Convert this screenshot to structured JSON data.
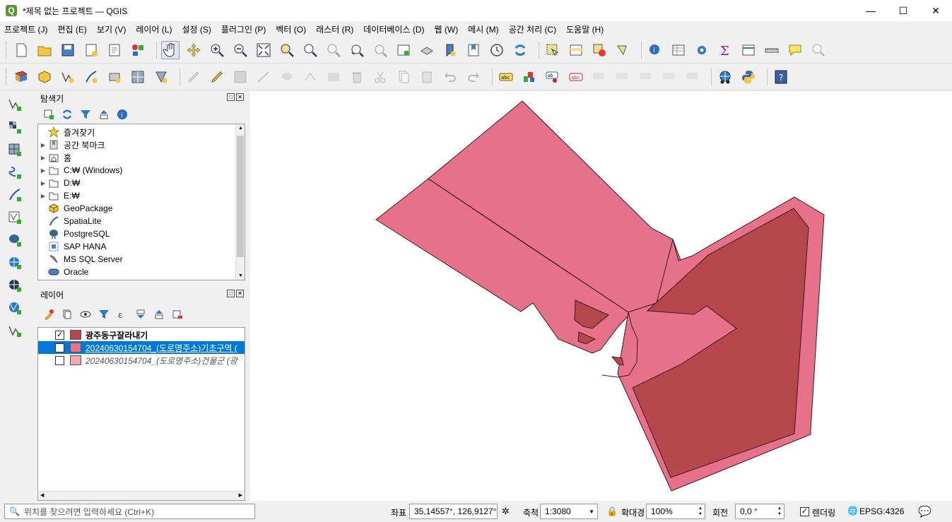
{
  "window": {
    "title": "*제목 없는 프로젝트 — QGIS",
    "app_letter": "Q"
  },
  "menu": [
    "프로젝트 (J)",
    "편집 (E)",
    "보기 (V)",
    "레이어 (L)",
    "설정 (S)",
    "플러그인 (P)",
    "벡터 (O)",
    "래스터 (R)",
    "데이터베이스 (D)",
    "웹 (W)",
    "메시 (M)",
    "공간 처리 (C)",
    "도움말 (H)"
  ],
  "browser": {
    "title": "탐색기",
    "items": [
      {
        "label": "즐겨찾기",
        "icon": "star-icon",
        "expandable": false
      },
      {
        "label": "공간 북마크",
        "icon": "bookmark-icon",
        "expandable": true
      },
      {
        "label": "홈",
        "icon": "home-folder-icon",
        "expandable": true
      },
      {
        "label": "C:₩ (Windows)",
        "icon": "folder-icon",
        "expandable": true
      },
      {
        "label": "D:₩",
        "icon": "folder-icon",
        "expandable": true
      },
      {
        "label": "E:₩",
        "icon": "folder-icon",
        "expandable": true
      },
      {
        "label": "GeoPackage",
        "icon": "geopackage-icon",
        "expandable": false
      },
      {
        "label": "SpatiaLite",
        "icon": "spatialite-icon",
        "expandable": false
      },
      {
        "label": "PostgreSQL",
        "icon": "postgresql-icon",
        "expandable": false
      },
      {
        "label": "SAP HANA",
        "icon": "sap-hana-icon",
        "expandable": false
      },
      {
        "label": "MS SQL Server",
        "icon": "mssql-icon",
        "expandable": false
      },
      {
        "label": "Oracle",
        "icon": "oracle-icon",
        "expandable": false
      }
    ]
  },
  "layers": {
    "title": "레이어",
    "items": [
      {
        "label": "광주동구잘라내기",
        "checked": true,
        "color": "#b5474d",
        "bold": true,
        "selected": false,
        "italic": false
      },
      {
        "label": "20240630154704_(도로명주소)기초구역 (",
        "checked": true,
        "color": "#e8738c",
        "bold": false,
        "selected": true,
        "italic": false
      },
      {
        "label": "20240630154704_(도로명주소)건물군 (광",
        "checked": false,
        "color": "#f2a9b3",
        "bold": false,
        "selected": false,
        "italic": true
      }
    ]
  },
  "map": {
    "fill_light": "#e8718a",
    "fill_dark": "#b5474d",
    "stroke": "#3a1a1f"
  },
  "status": {
    "locator_placeholder": "위치를 찾으려면 입력하세요 (Ctrl+K)",
    "coord_label": "좌표",
    "coord_value": "35,14557°, 126,9127°",
    "scale_label": "축척",
    "scale_value": "1:3080",
    "magnifier_label": "확대경",
    "magnifier_value": "100%",
    "rotation_label": "회전",
    "rotation_value": "0,0 °",
    "render_label": "렌더링",
    "crs": "EPSG:4326"
  }
}
